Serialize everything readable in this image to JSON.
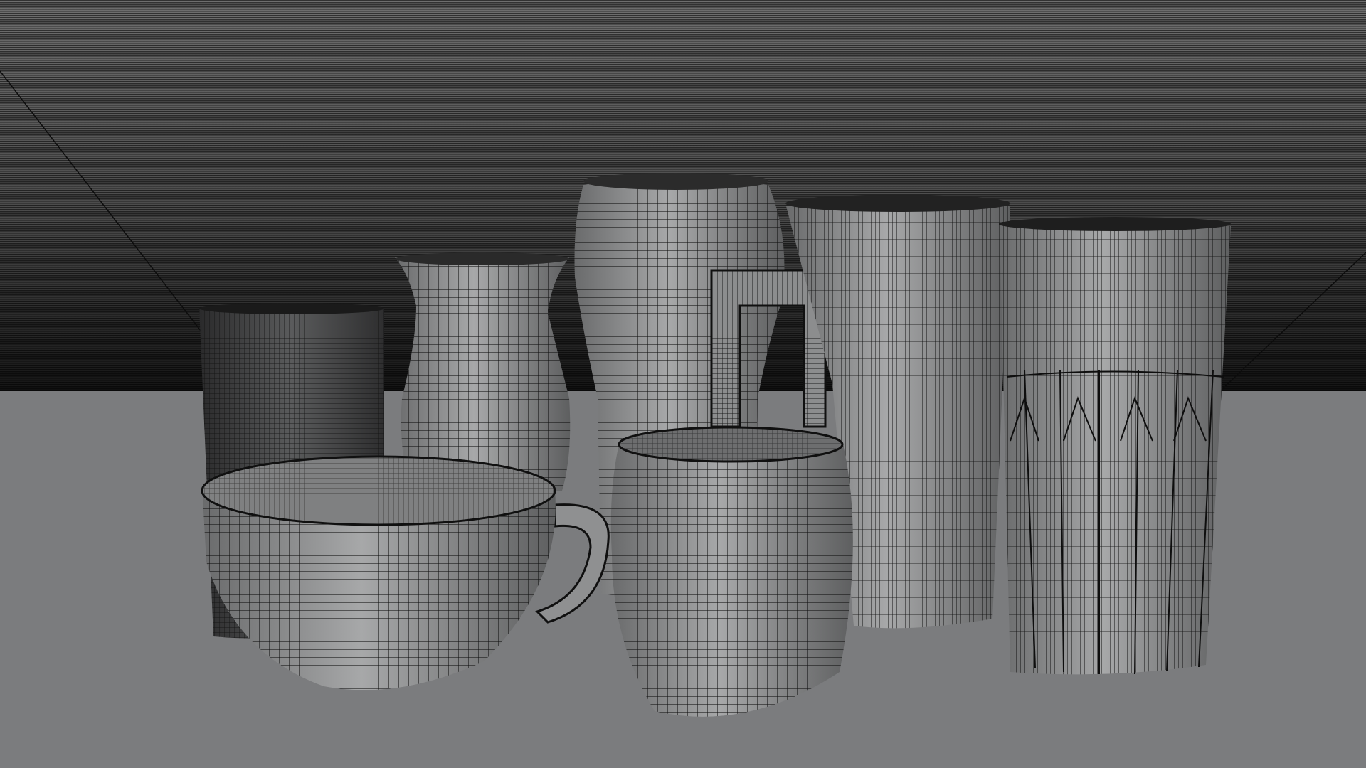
{
  "scene": {
    "objects": [
      {
        "name": "dark-cylinder-cup",
        "kind": "cylinder"
      },
      {
        "name": "flared-vase",
        "kind": "vase"
      },
      {
        "name": "pint-glass",
        "kind": "glass"
      },
      {
        "name": "beer-mug-with-handle",
        "kind": "mug"
      },
      {
        "name": "faceted-tumbler",
        "kind": "tumbler"
      },
      {
        "name": "tea-cup-with-handle",
        "kind": "cup"
      },
      {
        "name": "barrel-mug",
        "kind": "barrel"
      }
    ],
    "colors": {
      "floor": "#7b7c7e",
      "wall_top": "#6a6a6a",
      "wall_bottom": "#141414",
      "mesh_fill": "#9a9b9c",
      "wire": "#101010"
    }
  }
}
